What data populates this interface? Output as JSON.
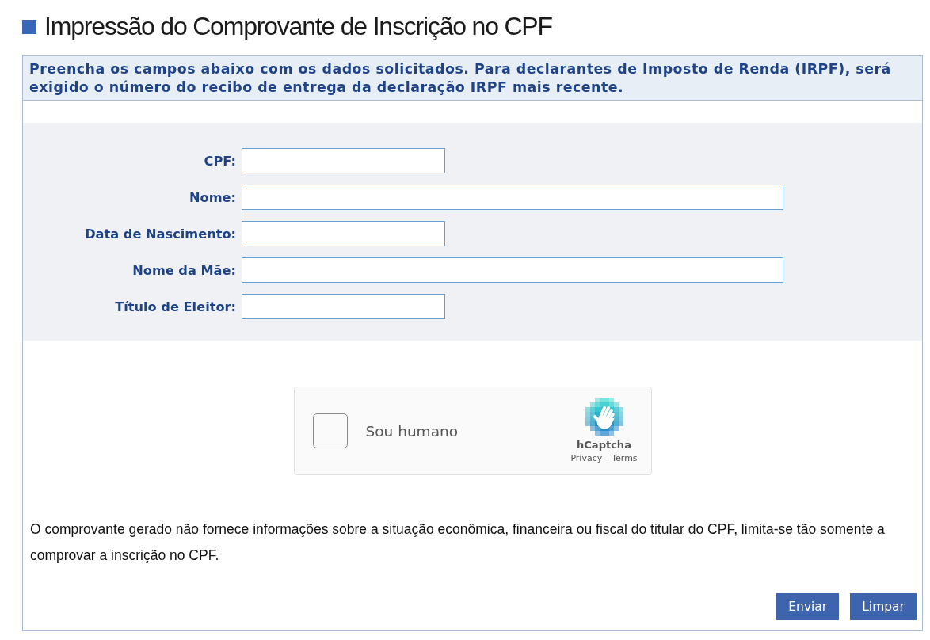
{
  "page": {
    "title": "Impressão do Comprovante de Inscrição no CPF"
  },
  "instructions": "Preencha os campos abaixo com os dados solicitados. Para declarantes de Imposto de Renda (IRPF), será exigido o número do recibo de entrega da declaração IRPF mais recente.",
  "form": {
    "fields": [
      {
        "label": "CPF:",
        "kind": "short"
      },
      {
        "label": "Nome:",
        "kind": "long"
      },
      {
        "label": "Data de Nascimento:",
        "kind": "short"
      },
      {
        "label": "Nome da Mãe:",
        "kind": "long"
      },
      {
        "label": "Título de Eleitor:",
        "kind": "short"
      }
    ]
  },
  "captcha": {
    "checked": false,
    "label": "Sou humano",
    "brand": "hCaptcha",
    "links": [
      {
        "label": "Privacy"
      },
      {
        "label": "Terms"
      }
    ],
    "link_separator": "-"
  },
  "notice": "O comprovante gerado não fornece informações sobre a situação econômica, financeira ou fiscal do titular do CPF, limita-se tão somente a comprovar a inscrição no CPF.",
  "buttons": [
    {
      "label": "Enviar"
    },
    {
      "label": "Limpar"
    }
  ]
}
